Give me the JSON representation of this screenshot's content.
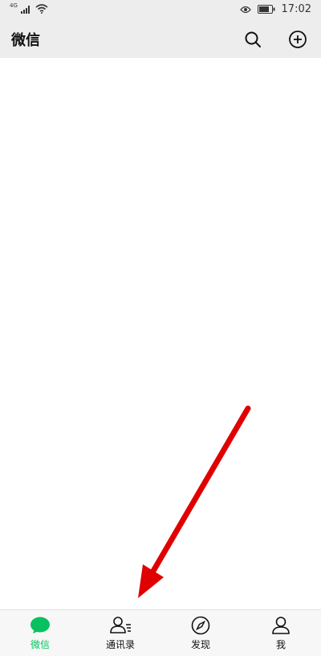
{
  "status_bar": {
    "network": "4G",
    "time": "17:02"
  },
  "header": {
    "title": "微信"
  },
  "tabs": [
    {
      "label": "微信",
      "icon": "chat-bubble-icon",
      "active": true
    },
    {
      "label": "通讯录",
      "icon": "contacts-icon",
      "active": false
    },
    {
      "label": "发现",
      "icon": "compass-icon",
      "active": false
    },
    {
      "label": "我",
      "icon": "person-icon",
      "active": false
    }
  ],
  "colors": {
    "accent": "#07c160",
    "header_bg": "#ededed",
    "annotation_arrow": "#e00000"
  }
}
